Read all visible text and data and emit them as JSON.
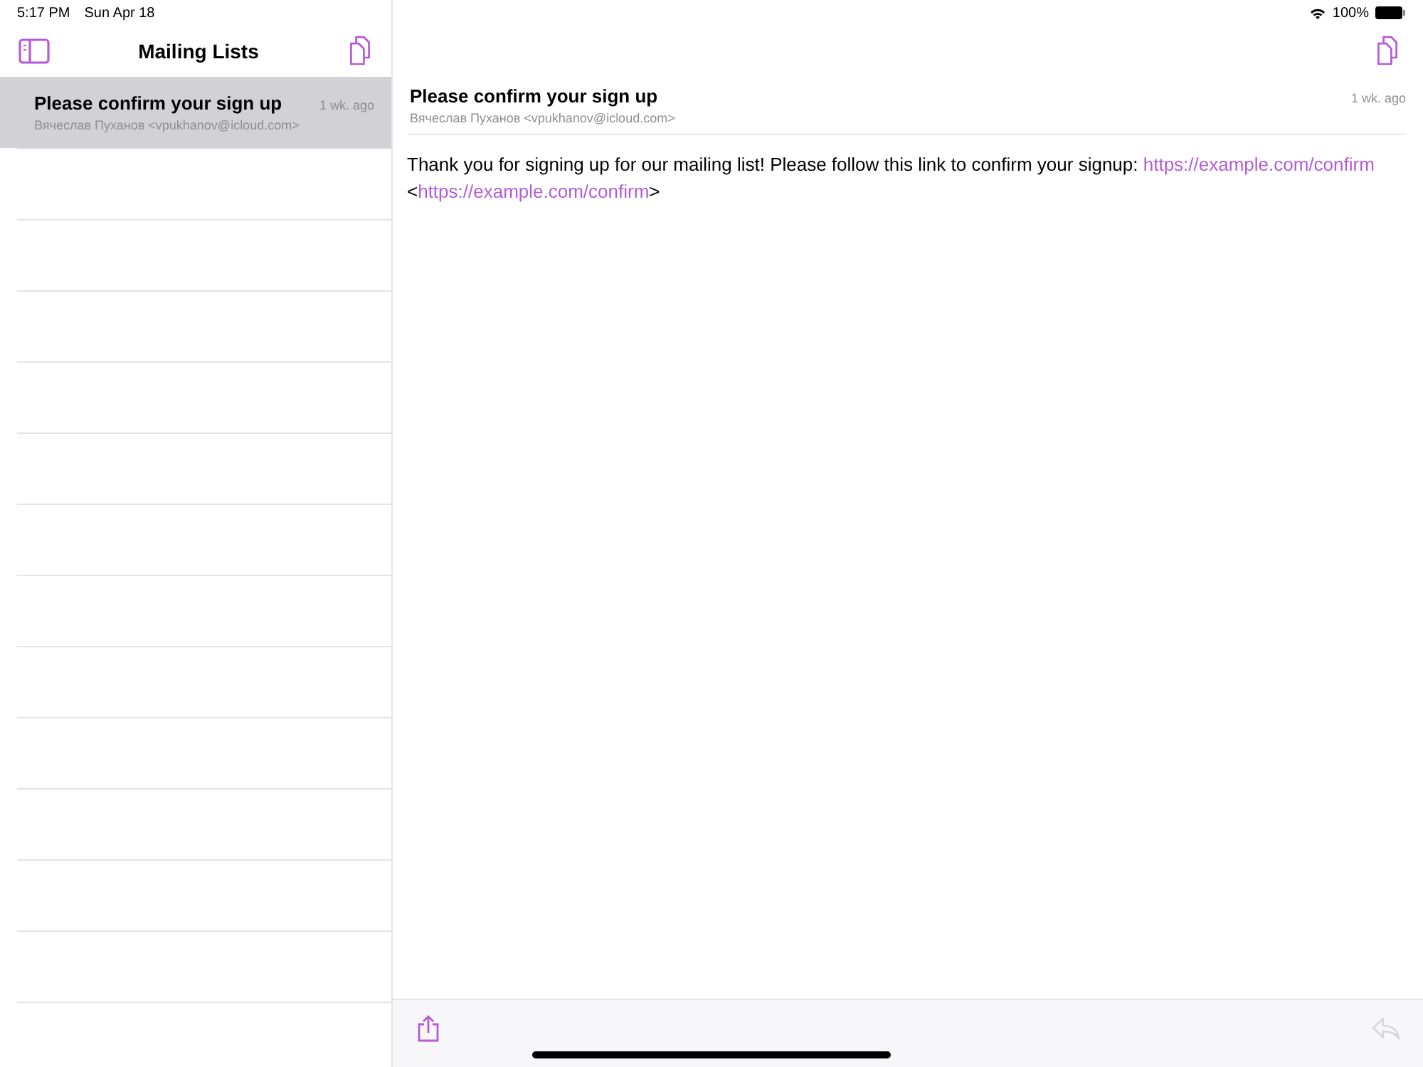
{
  "status_bar": {
    "time": "5:17 PM",
    "date": "Sun Apr 18",
    "battery": "100%"
  },
  "sidebar": {
    "title": "Mailing Lists",
    "items": [
      {
        "subject": "Please confirm your sign up",
        "sender": "Вячеслав Пуханов <vpukhanov@icloud.com>",
        "time": "1 wk. ago",
        "selected": true
      }
    ]
  },
  "message": {
    "subject": "Please confirm your sign up",
    "sender": "Вячеслав Пуханов <vpukhanov@icloud.com>",
    "time": "1 wk. ago",
    "body": [
      {
        "kind": "text",
        "text": "Thank you for signing up for our mailing list! Please follow this link to confirm your signup: "
      },
      {
        "kind": "link",
        "text": "https://example.com/confirm"
      },
      {
        "kind": "text",
        "text": " <"
      },
      {
        "kind": "link",
        "text": "https://example.com/confirm"
      },
      {
        "kind": "text",
        "text": ">"
      }
    ]
  },
  "toolbar": {
    "reply_disabled": true
  }
}
